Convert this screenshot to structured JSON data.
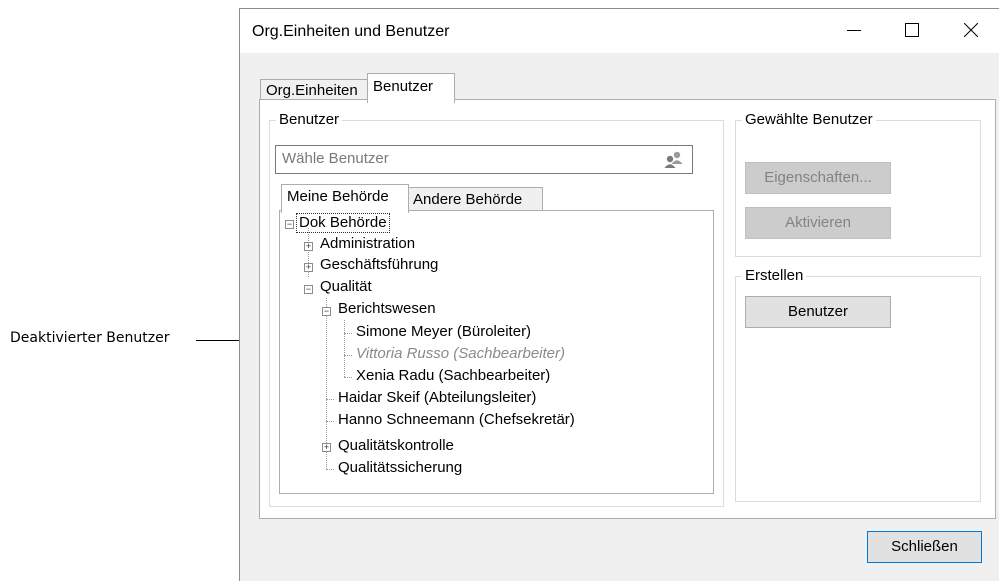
{
  "annotation": {
    "label": "Deaktivierter Benutzer"
  },
  "window": {
    "title": "Org.Einheiten und Benutzer",
    "controls": {
      "minimize": "minimize-icon",
      "maximize": "maximize-icon",
      "close": "close-icon"
    }
  },
  "outer_tabs": [
    {
      "label": "Org.Einheiten",
      "active": false
    },
    {
      "label": "Benutzer",
      "active": true
    }
  ],
  "benutzer_group": {
    "legend": "Benutzer",
    "search": {
      "placeholder": "Wähle Benutzer",
      "value": "",
      "icon": "users-icon"
    },
    "inner_tabs": [
      {
        "label": "Meine Behörde",
        "active": true
      },
      {
        "label": "Andere Behörde",
        "active": false
      }
    ],
    "tree": {
      "root": "Dok Behörde",
      "administration": "Administration",
      "geschaeftsfuehrung": "Geschäftsführung",
      "qualitaet": "Qualität",
      "berichtswesen": "Berichtswesen",
      "user_meyer": "Simone Meyer (Büroleiter)",
      "user_russo": "Vittoria Russo (Sachbearbeiter)",
      "user_radu": "Xenia Radu (Sachbearbeiter)",
      "user_skeif": "Haidar Skeif (Abteilungsleiter)",
      "user_schneemann": "Hanno Schneemann (Chefsekretär)",
      "qualitaetskontrolle": "Qualitätskontrolle",
      "qualitaetssicherung": "Qualitätssicherung"
    }
  },
  "selected_group": {
    "legend": "Gewählte Benutzer",
    "properties_button": "Eigenschaften...",
    "activate_button": "Aktivieren"
  },
  "create_group": {
    "legend": "Erstellen",
    "user_button": "Benutzer"
  },
  "footer": {
    "close_button": "Schließen"
  },
  "colors": {
    "accent": "#0078d7",
    "disabled_text": "#838383",
    "inactive_user": "#8a8a8a"
  }
}
